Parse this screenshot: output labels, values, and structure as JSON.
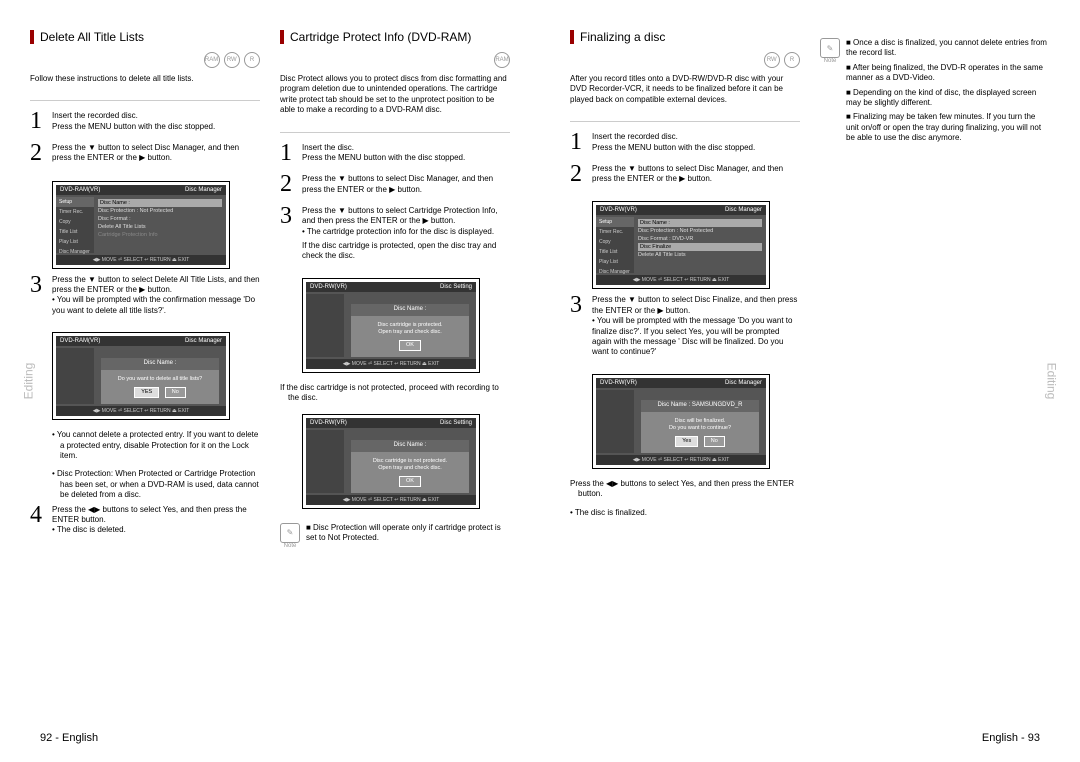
{
  "page_left": {
    "side_label": "Editing",
    "footer": "92 - English",
    "sectionA": {
      "heading": "Delete All Title Lists",
      "disc_icons": [
        "RAM",
        "RW",
        "R"
      ],
      "intro": "Follow these instructions to delete all title lists.",
      "step1a": "Insert the recorded disc.",
      "step1b": "Press the MENU button with the disc stopped.",
      "step2": "Press the ▼ button to select Disc Manager, and then press the ENTER or the ▶ button.",
      "osd1": {
        "title_l": "DVD-RAM(VR)",
        "title_r": "Disc Manager",
        "side": [
          "Setup",
          "Timer Rec.",
          "Copy",
          "Title List",
          "Play List",
          "Disc Manager"
        ],
        "rows": [
          "Disc Name  :",
          "Disc Protection : Not Protected",
          "Disc Format  :",
          "Delete All Title Lists",
          "Cartridge Protection Info"
        ],
        "footer": "◀▶ MOVE   ⏎ SELECT   ↩ RETURN   ⏏ EXIT"
      },
      "step3a": "Press the ▼ button to select Delete All Title Lists, and then press the ENTER or the ▶ button.",
      "step3b": "• You will be prompted with the confirmation message  'Do you want to delete all title lists?'.",
      "osd2": {
        "title_l": "DVD-RAM(VR)",
        "title_r": "Disc Manager",
        "dlg_title": "Disc Name  :",
        "dlg_msg": "Do you want to delete all title lists?",
        "btn_yes": "YES",
        "btn_no": "No",
        "footer": "◀▶ MOVE   ⏎ SELECT   ↩ RETURN   ⏏ EXIT"
      },
      "bul1": "• You cannot delete a protected entry. If you want to delete a protected entry, disable Protection for it on the Lock item.",
      "bul2": "• Disc Protection: When Protected or Cartridge Protection has been set, or when a DVD-RAM is used, data cannot be deleted from a disc.",
      "step4a": "Press the ◀▶ buttons to select Yes, and then press the ENTER button.",
      "step4b": "• The disc is deleted."
    },
    "sectionB": {
      "heading": "Cartridge Protect Info (DVD-RAM)",
      "disc_icons": [
        "RAM"
      ],
      "intro": "Disc Protect allows you to protect discs from disc formatting and program deletion due to unintended operations. The cartridge write protect tab should be set to the unprotect position to be able to make a recording to a DVD-RAM disc.",
      "step1a": "Insert the disc.",
      "step1b": "Press the MENU button with the disc stopped.",
      "step2": "Press the ▼ buttons to select Disc Manager, and then press the ENTER or the ▶ button.",
      "step3a": "Press the ▼ buttons to select Cartridge Protection Info, and then press the ENTER or the ▶ button.",
      "step3b": "• The cartridge protection info for the disc is displayed.",
      "step3c": "If the disc cartridge is protected, open the disc tray and check the disc.",
      "osd1": {
        "title_l": "DVD-RW(VR)",
        "title_r": "Disc Setting",
        "dlg_title": "Disc Name  :",
        "dlg_line1": "Disc cartridge is protected.",
        "dlg_line2": "Open tray and check disc.",
        "btn": "OK",
        "footer": "◀▶ MOVE   ⏎ SELECT   ↩ RETURN   ⏏ EXIT"
      },
      "step3d": "If the disc cartridge is not protected, proceed with recording to the disc.",
      "osd2": {
        "title_l": "DVD-RW(VR)",
        "title_r": "Disc Setting",
        "dlg_title": "Disc Name  :",
        "dlg_line1": "Disc cartridge is not protected.",
        "dlg_line2": "Open tray and check disc.",
        "btn": "OK",
        "footer": "◀▶ MOVE   ⏎ SELECT   ↩ RETURN   ⏏ EXIT"
      },
      "note": "■ Disc Protection will operate only if cartridge protect is set to Not Protected.",
      "note_label": "Note"
    }
  },
  "page_right": {
    "side_label": "Editing",
    "footer": "English - 93",
    "sectionC": {
      "heading": "Finalizing a disc",
      "disc_icons": [
        "RW",
        "R"
      ],
      "intro": "After you record titles onto a DVD-RW/DVD-R disc with your DVD Recorder-VCR, it needs to be finalized before it can be played back on compatible external devices.",
      "step1a": "Insert the recorded disc.",
      "step1b": "Press the MENU button with the disc stopped.",
      "step2": "Press the ▼ buttons to select Disc Manager, and then press the ENTER or the ▶ button.",
      "osd1": {
        "title_l": "DVD-RW(VR)",
        "title_r": "Disc Manager",
        "side": [
          "Setup",
          "Timer Rec.",
          "Copy",
          "Title List",
          "Play List",
          "Disc Manager"
        ],
        "rows": [
          "Disc Name  :",
          "Disc Protection : Not Protected",
          "Disc Format  : DVD-VR",
          "Disc Finalize",
          "Delete All Title Lists"
        ],
        "footer": "◀▶ MOVE   ⏎ SELECT   ↩ RETURN   ⏏ EXIT"
      },
      "step3a": "Press the ▼ button to select Disc Finalize, and then press the ENTER or the ▶ button.",
      "step3b": "• You will be prompted with the message 'Do you want to finalize disc?'. If you select Yes, you will be prompted again with the message ' Disc will be finalized. Do you want to continue?'",
      "osd2": {
        "title_l": "DVD-RW(VR)",
        "title_r": "Disc Manager",
        "dlg_title": "Disc Name  :  SAMSUNGDVD_R",
        "dlg_line1": "Disc will be finalized.",
        "dlg_line2": "Do you want to continue?",
        "btn_yes": "Yes",
        "btn_no": "No",
        "footer": "◀▶ MOVE   ⏎ SELECT   ↩ RETURN   ⏏ EXIT"
      },
      "step_after": "Press the ◀▶ buttons to select Yes, and then press the ENTER button.",
      "bul_final": "• The disc is finalized."
    },
    "notes": {
      "label": "Note",
      "n1": "■ Once a disc is finalized, you cannot delete entries from the record list.",
      "n2": "■ After being finalized, the DVD-R operates in the same manner as a DVD-Video.",
      "n3": "■ Depending on the kind of disc, the displayed screen may be slightly different.",
      "n4": "■ Finalizing may be taken few minutes. If you turn the unit on/off or open the tray during finalizing, you will not be able to use the disc anymore."
    }
  }
}
